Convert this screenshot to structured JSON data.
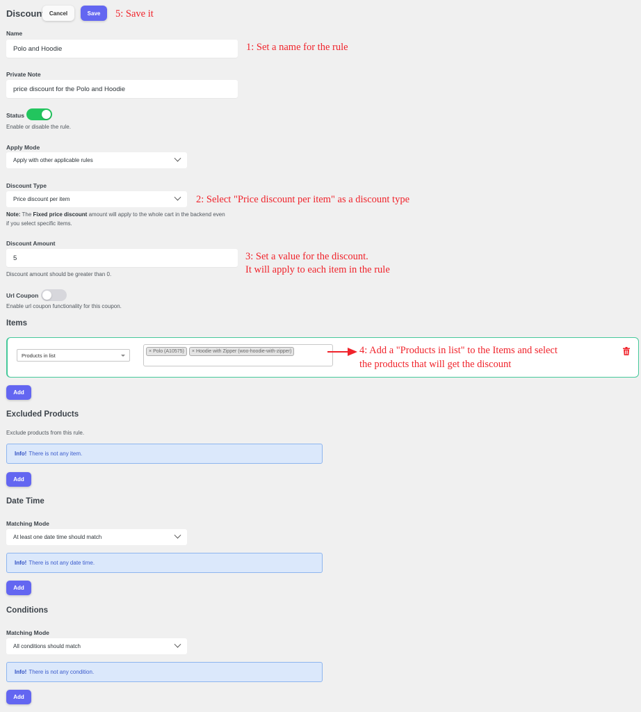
{
  "header": {
    "title": "Discount",
    "cancel_label": "Cancel",
    "save_label": "Save"
  },
  "annotations": {
    "step1": "1: Set a name for the rule",
    "step2": "2: Select \"Price discount per item\" as a discount type",
    "step3_line1": "3: Set a value for the discount.",
    "step3_line2": "It will apply to each item in the rule",
    "step4_line1": "4: Add a \"Products in list\" to the Items and select",
    "step4_line2": "the products that will get the discount",
    "step5": "5: Save it",
    "color": "#f0232b"
  },
  "form": {
    "name": {
      "label": "Name",
      "value": "Polo and Hoodie"
    },
    "private_note": {
      "label": "Private Note",
      "value": "price discount for the Polo and Hoodie"
    },
    "status": {
      "label": "Status",
      "enabled": true,
      "help": "Enable or disable the rule."
    },
    "apply_mode": {
      "label": "Apply Mode",
      "selected": "Apply with other applicable rules"
    },
    "discount_type": {
      "label": "Discount Type",
      "selected": "Price discount per item",
      "note_prefix": "Note:",
      "note_text_1": " The ",
      "note_bold": "Fixed price discount",
      "note_text_2": " amount will apply to the whole cart in the backend even",
      "note_text_3": "if you select specific items."
    },
    "discount_amount": {
      "label": "Discount Amount",
      "value": "5",
      "help": "Discount amount should be greater than 0."
    },
    "url_coupon": {
      "label": "Url Coupon",
      "enabled": false,
      "help": "Enable url coupon functionality for this coupon."
    }
  },
  "items": {
    "title": "Items",
    "rows": [
      {
        "type": "Products in list",
        "products": [
          "Polo (A10575)",
          "Hoodie with Zipper (woo-hoodie-with-zipper)"
        ]
      }
    ],
    "add_label": "Add"
  },
  "excluded_products": {
    "title": "Excluded Products",
    "help": "Exclude products from this rule.",
    "info_label": "Info!",
    "info_text": "There is not any item.",
    "add_label": "Add"
  },
  "date_time": {
    "title": "Date Time",
    "matching_label": "Matching Mode",
    "matching_selected": "At least one date time should match",
    "info_label": "Info!",
    "info_text": "There is not any date time.",
    "add_label": "Add"
  },
  "conditions": {
    "title": "Conditions",
    "matching_label": "Matching Mode",
    "matching_selected": "All conditions should match",
    "info_label": "Info!",
    "info_text": "There is not any condition.",
    "add_label": "Add"
  },
  "colors": {
    "primary": "#6366f1",
    "toggle_on": "#22c55e",
    "item_border": "#45c89a",
    "info_bg": "#dbe8fb",
    "delete": "#f0232b"
  }
}
